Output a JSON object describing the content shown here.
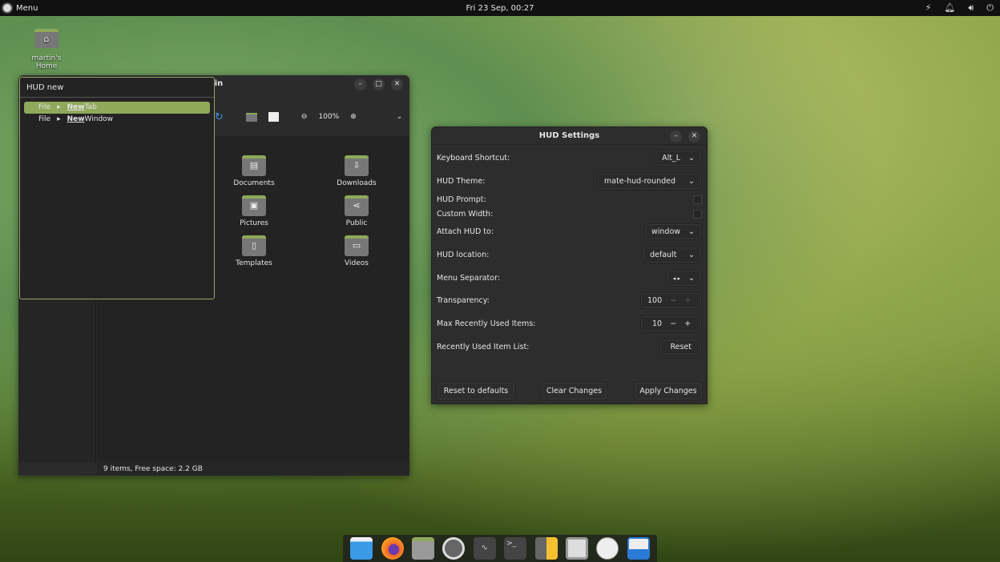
{
  "topbar": {
    "menu_label": "Menu",
    "clock": "Fri 23 Sep, 00:27",
    "tray_icons": [
      "network-icon",
      "bell-icon",
      "volume-icon",
      "power-icon"
    ]
  },
  "desktop": {
    "home_label": "martin's Home"
  },
  "file_manager": {
    "title_fragment": "rtin",
    "zoom": "100%",
    "items": [
      "Documents",
      "Downloads",
      "Pictures",
      "Public",
      "Templates",
      "Videos"
    ],
    "status": "9 items, Free space: 2.2 GB"
  },
  "hud": {
    "query": "HUD  new",
    "results": [
      {
        "menu": "File",
        "match": "New",
        "rest": "Tab",
        "selected": true
      },
      {
        "menu": "File",
        "match": "New",
        "rest": "Window",
        "selected": false
      }
    ],
    "accent": "#8fa85a"
  },
  "hud_settings": {
    "title": "HUD Settings",
    "keyboard_shortcut": {
      "label": "Keyboard Shortcut:",
      "value": "Alt_L"
    },
    "theme": {
      "label": "HUD Theme:",
      "value": "mate-hud-rounded"
    },
    "prompt": {
      "label": "HUD Prompt:",
      "checked": false
    },
    "custom_width": {
      "label": "Custom Width:",
      "checked": false
    },
    "attach": {
      "label": "Attach HUD to:",
      "value": "window"
    },
    "location": {
      "label": "HUD location:",
      "value": "default"
    },
    "separator": {
      "label": "Menu Separator:",
      "value": "◂ ▸"
    },
    "transparency": {
      "label": "Transparency:",
      "value": "100"
    },
    "max_recent": {
      "label": "Max Recently Used Items:",
      "value": "10"
    },
    "recent_list": {
      "label": "Recently Used Item List:",
      "button": "Reset"
    },
    "buttons": {
      "reset_defaults": "Reset to defaults",
      "clear": "Clear Changes",
      "apply": "Apply Changes"
    }
  },
  "dock": {
    "apps": [
      "desktop-icon",
      "firefox-icon",
      "files-icon",
      "settings-icon",
      "system-monitor-icon",
      "terminal-icon",
      "calculator-icon",
      "text-editor-icon",
      "clock-icon",
      "recycle-icon"
    ]
  }
}
